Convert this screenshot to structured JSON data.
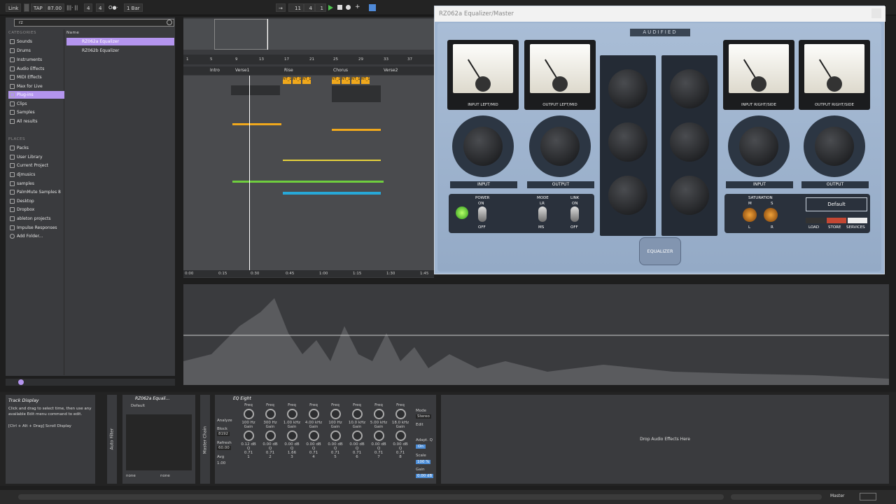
{
  "topbar": {
    "link": "Link",
    "tap": "TAP",
    "tempo": "87.00",
    "sig_num": "4",
    "sig_den": "4",
    "quant": "1 Bar",
    "bar": "11",
    "beat": "4",
    "sixteenth": "1"
  },
  "browser": {
    "search_value": "rz",
    "categories_header": "CATEGORIES",
    "categories": [
      "Sounds",
      "Drums",
      "Instruments",
      "Audio Effects",
      "MIDI Effects",
      "Max for Live",
      "Plug-ins",
      "Clips",
      "Samples",
      "All results"
    ],
    "places_header": "PLACES",
    "places": [
      "Packs",
      "User Library",
      "Current Project",
      "djmusics",
      "samples",
      "PalmMute Samples 8",
      "Desktop",
      "Dropbox",
      "ableton projects",
      "Impulse Responses",
      "Add Folder..."
    ],
    "name_header": "Name",
    "results": [
      "RZ062a Equalizer",
      "RZ062b Equalizer"
    ]
  },
  "arrangement": {
    "ruler": [
      "1",
      "5",
      "9",
      "13",
      "17",
      "21",
      "25",
      "29",
      "33",
      "37"
    ],
    "locators": [
      "Intro",
      "Verse1",
      "Rise",
      "Chorus",
      "Verse2"
    ],
    "clip_label": "NT_1",
    "times": [
      "0:00",
      "0:15",
      "0:30",
      "0:45",
      "1:00",
      "1:15",
      "1:30",
      "1:45"
    ]
  },
  "plugin": {
    "title": "RZ062a Equalizer/Master",
    "brand": "AUDIFIED",
    "model": "EQUALIZER",
    "meters": [
      "INPUT LEFT/MID",
      "OUTPUT LEFT/MID",
      "INPUT RIGHT/SIDE",
      "OUTPUT RIGHT/SIDE"
    ],
    "knobs": [
      "INPUT",
      "OUTPUT",
      "INPUT",
      "OUTPUT"
    ],
    "power": "POWER",
    "on": "ON",
    "off": "OFF",
    "mode": "MODE",
    "lr": "LR",
    "ms": "MS",
    "link": "LINK",
    "link_on": "ON",
    "link_off": "OFF",
    "saturation": "SATURATION",
    "sat_m": "M",
    "sat_s": "S",
    "sat_l": "L",
    "sat_r": "R",
    "preset": "Default",
    "load": "LOAD",
    "store": "STORE",
    "services": "SERVICES"
  },
  "info": {
    "title": "Track Display",
    "body": "Click and drag to select time, then use any available Edit menu command to edit.",
    "shortcut": "[Ctrl + Alt + Drag] Scroll Display"
  },
  "devices": {
    "auto_filter": "Auto Filter",
    "rack_title": "RZ062a Equali...",
    "rack_preset": "Default",
    "rack_none_l": "none",
    "rack_none_r": "none",
    "master_chain": "Master Chain",
    "eq_title": "EQ Eight",
    "analyze": "Analyze",
    "block": "Block",
    "block_val": "8192",
    "refresh": "Refresh",
    "refresh_val": "60.00",
    "avg": "Avg",
    "avg_val": "1.00",
    "freq_label": "Freq",
    "gain_label": "Gain",
    "q_label": "Q",
    "bands": [
      {
        "freq": "100 Hz",
        "gain": "0.12 dB",
        "q": "0.71",
        "n": "1"
      },
      {
        "freq": "300 Hz",
        "gain": "0.00 dB",
        "q": "0.71",
        "n": "2"
      },
      {
        "freq": "1.00 kHz",
        "gain": "0.00 dB",
        "q": "1.66",
        "n": "3"
      },
      {
        "freq": "4.00 kHz",
        "gain": "0.00 dB",
        "q": "0.71",
        "n": "4"
      },
      {
        "freq": "100 Hz",
        "gain": "0.00 dB",
        "q": "0.71",
        "n": "5"
      },
      {
        "freq": "10.0 kHz",
        "gain": "0.00 dB",
        "q": "0.71",
        "n": "6"
      },
      {
        "freq": "5.00 kHz",
        "gain": "0.00 dB",
        "q": "0.71",
        "n": "7"
      },
      {
        "freq": "18.0 kHz",
        "gain": "0.00 dB",
        "q": "0.71",
        "n": "8"
      }
    ],
    "mode_label": "Mode",
    "mode_val": "Stereo",
    "edit_label": "Edit",
    "adapt_q": "Adapt. Q",
    "adapt_on": "On",
    "scale": "Scale",
    "scale_val": "100 %",
    "gain2": "Gain",
    "gain2_val": "0.00 dB",
    "drop": "Drop Audio Effects Here"
  },
  "statusbar": {
    "master": "Master"
  }
}
